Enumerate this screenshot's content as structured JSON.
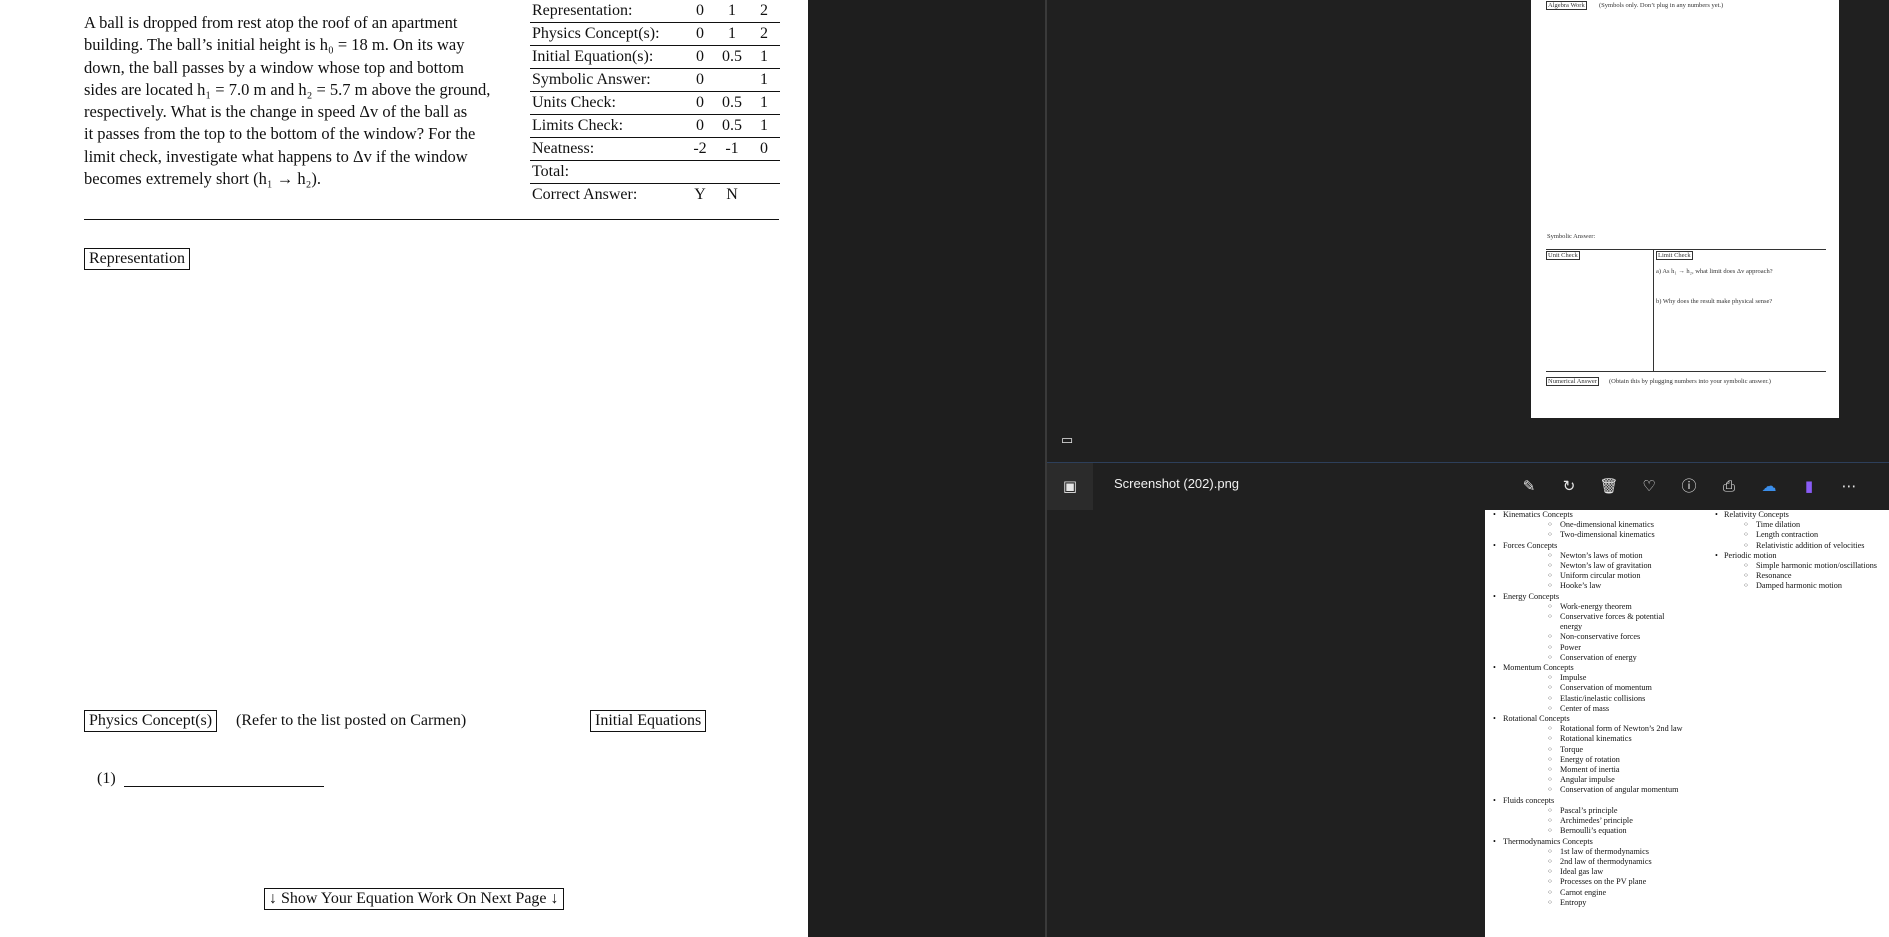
{
  "problem": {
    "line1": "A ball is dropped from rest atop the roof of an apartment",
    "line2": "building. The ball’s initial height is h₀ = 18 m. On its way",
    "line3": "down, the ball passes by a window whose top and bottom",
    "line4": "sides are located h₁ = 7.0 m and h₂ = 5.7 m above the ground,",
    "line5": "respectively. What is the change in speed Δv of the ball as",
    "line6": "it passes from the top to the bottom of the window? For the",
    "line7": "limit check, investigate what happens to Δv if the window",
    "line8": "becomes extremely short (h₁ → h₂)."
  },
  "rubric": [
    {
      "label": "Representation:",
      "s1": "0",
      "s2": "1",
      "s3": "2"
    },
    {
      "label": "Physics Concept(s):",
      "s1": "0",
      "s2": "1",
      "s3": "2"
    },
    {
      "label": "Initial Equation(s):",
      "s1": "0",
      "s2": "0.5",
      "s3": "1"
    },
    {
      "label": "Symbolic Answer:",
      "s1": "0",
      "s2": "",
      "s3": "1"
    },
    {
      "label": "Units Check:",
      "s1": "0",
      "s2": "0.5",
      "s3": "1"
    },
    {
      "label": "Limits Check:",
      "s1": "0",
      "s2": "0.5",
      "s3": "1"
    },
    {
      "label": "Neatness:",
      "s1": "-2",
      "s2": "-1",
      "s3": "0"
    },
    {
      "label": "Total:",
      "s1": "",
      "s2": "",
      "s3": ""
    },
    {
      "label": "Correct Answer:",
      "s1": "Y",
      "s2": "N",
      "s3": ""
    }
  ],
  "sections": {
    "representation": "Representation",
    "physics_concepts": "Physics Concept(s)",
    "physics_note": "(Refer to the list posted on Carmen)",
    "initial_equations": "Initial Equations",
    "blank1": "(1)",
    "next_page": "↓ Show Your Equation Work On Next Page ↓"
  },
  "page2": {
    "algebra_title": "Algebra Work",
    "algebra_note": "(Symbols only. Don’t plug in any numbers yet.)",
    "symbolic_answer": "Symbolic Answer:",
    "unit_check": "Unit Check",
    "limit_check": "Limit Check",
    "limit_a": "a) As h₁ → h₂, what limit does Δv approach?",
    "limit_b": "b) Why does the result make physical sense?",
    "numerical_title": "Numerical Answer",
    "numerical_note": "(Obtain this by plugging numbers into your symbolic answer.)"
  },
  "viewer": {
    "filename": "Screenshot (202).png",
    "icons": [
      "edit-icon",
      "rotate-icon",
      "delete-icon",
      "favorite-icon",
      "info-icon",
      "print-icon",
      "onedrive-icon",
      "clipchamp-icon",
      "more-icon"
    ]
  },
  "concepts_col1": [
    {
      "cat": "Kinematics Concepts",
      "subs": [
        "One-dimensional kinematics",
        "Two-dimensional kinematics"
      ]
    },
    {
      "cat": "Forces Concepts",
      "subs": [
        "Newton’s laws of motion",
        "Newton’s law of gravitation",
        "Uniform circular motion",
        "Hooke’s law"
      ]
    },
    {
      "cat": "Energy Concepts",
      "subs": [
        "Work-energy theorem",
        "Conservative forces & potential energy",
        "Non-conservative forces",
        "Power",
        "Conservation of energy"
      ]
    },
    {
      "cat": "Momentum Concepts",
      "subs": [
        "Impulse",
        "Conservation of momentum",
        "Elastic/inelastic collisions",
        "Center of mass"
      ]
    },
    {
      "cat": "Rotational Concepts",
      "subs": [
        "Rotational form of Newton’s 2nd law",
        "Rotational kinematics",
        "Torque",
        "Energy of rotation",
        "Moment of inertia",
        "Angular impulse",
        "Conservation of angular momentum"
      ]
    },
    {
      "cat": "Fluids concepts",
      "subs": [
        "Pascal’s principle",
        "Archimedes’ principle",
        "Bernoulli’s equation"
      ]
    },
    {
      "cat": "Thermodynamics Concepts",
      "subs": [
        "1st law of thermodynamics",
        "2nd law of thermodynamics",
        "Ideal gas law",
        "Processes on the PV plane",
        "Carnot engine",
        "Entropy"
      ]
    }
  ],
  "concepts_col2": [
    {
      "cat": "Relativity Concepts",
      "subs": [
        "Time dilation",
        "Length contraction",
        "Relativistic addition of velocities"
      ]
    },
    {
      "cat": "Periodic motion",
      "subs": [
        "Simple harmonic motion/oscillations",
        "Resonance",
        "Damped harmonic motion"
      ]
    }
  ]
}
